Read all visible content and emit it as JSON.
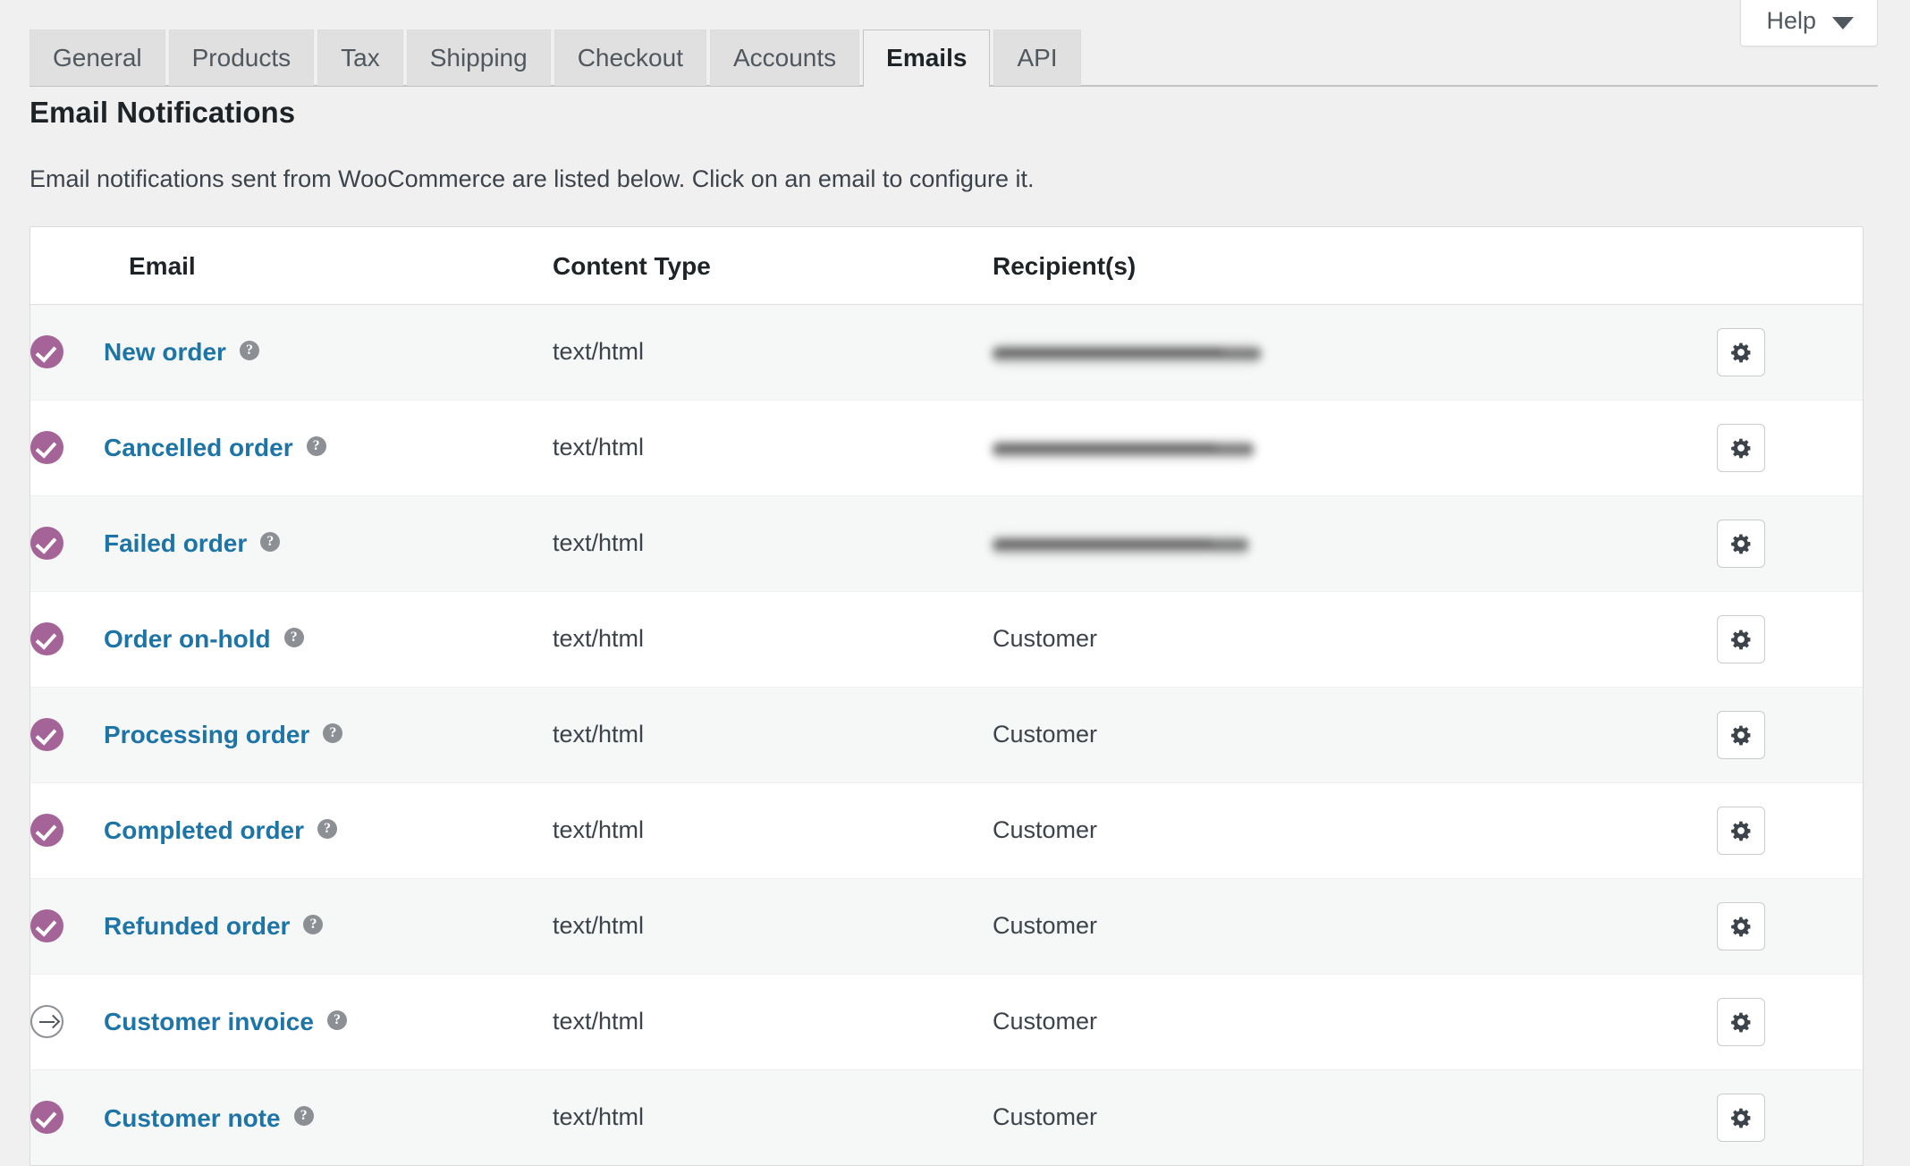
{
  "header": {
    "help_button_label": "Help",
    "help_caret_icon": "chevron-down-icon"
  },
  "tabs": [
    {
      "label": "General",
      "active": false
    },
    {
      "label": "Products",
      "active": false
    },
    {
      "label": "Tax",
      "active": false
    },
    {
      "label": "Shipping",
      "active": false
    },
    {
      "label": "Checkout",
      "active": false
    },
    {
      "label": "Accounts",
      "active": false
    },
    {
      "label": "Emails",
      "active": true
    },
    {
      "label": "API",
      "active": false
    }
  ],
  "section": {
    "title": "Email Notifications",
    "description": "Email notifications sent from WooCommerce are listed below. Click on an email to configure it."
  },
  "table": {
    "columns": {
      "status": "",
      "email": "Email",
      "content_type": "Content Type",
      "recipients": "Recipient(s)",
      "actions": ""
    },
    "help_tip_glyph": "?",
    "rows": [
      {
        "status": "enabled",
        "status_icon": "check-circle-icon",
        "email": "New order",
        "content_type": "text/html",
        "recipient": "",
        "recipient_redacted": true,
        "action_icon": "gear-icon"
      },
      {
        "status": "enabled",
        "status_icon": "check-circle-icon",
        "email": "Cancelled order",
        "content_type": "text/html",
        "recipient": "",
        "recipient_redacted": true,
        "action_icon": "gear-icon"
      },
      {
        "status": "enabled",
        "status_icon": "check-circle-icon",
        "email": "Failed order",
        "content_type": "text/html",
        "recipient": "",
        "recipient_redacted": true,
        "action_icon": "gear-icon"
      },
      {
        "status": "enabled",
        "status_icon": "check-circle-icon",
        "email": "Order on-hold",
        "content_type": "text/html",
        "recipient": "Customer",
        "recipient_redacted": false,
        "action_icon": "gear-icon"
      },
      {
        "status": "enabled",
        "status_icon": "check-circle-icon",
        "email": "Processing order",
        "content_type": "text/html",
        "recipient": "Customer",
        "recipient_redacted": false,
        "action_icon": "gear-icon"
      },
      {
        "status": "enabled",
        "status_icon": "check-circle-icon",
        "email": "Completed order",
        "content_type": "text/html",
        "recipient": "Customer",
        "recipient_redacted": false,
        "action_icon": "gear-icon"
      },
      {
        "status": "enabled",
        "status_icon": "check-circle-icon",
        "email": "Refunded order",
        "content_type": "text/html",
        "recipient": "Customer",
        "recipient_redacted": false,
        "action_icon": "gear-icon"
      },
      {
        "status": "manual",
        "status_icon": "arrow-circle-icon",
        "email": "Customer invoice",
        "content_type": "text/html",
        "recipient": "Customer",
        "recipient_redacted": false,
        "action_icon": "gear-icon"
      },
      {
        "status": "enabled",
        "status_icon": "check-circle-icon",
        "email": "Customer note",
        "content_type": "text/html",
        "recipient": "Customer",
        "recipient_redacted": false,
        "action_icon": "gear-icon"
      }
    ]
  },
  "colors": {
    "status_enabled": "#a46497",
    "status_manual": "#8c8f94",
    "link": "#1d74a6",
    "page_background": "#f0f0f1",
    "row_stripe": "#f6f7f7",
    "row_plain": "#ffffff",
    "heading_text": "#1d2327"
  }
}
